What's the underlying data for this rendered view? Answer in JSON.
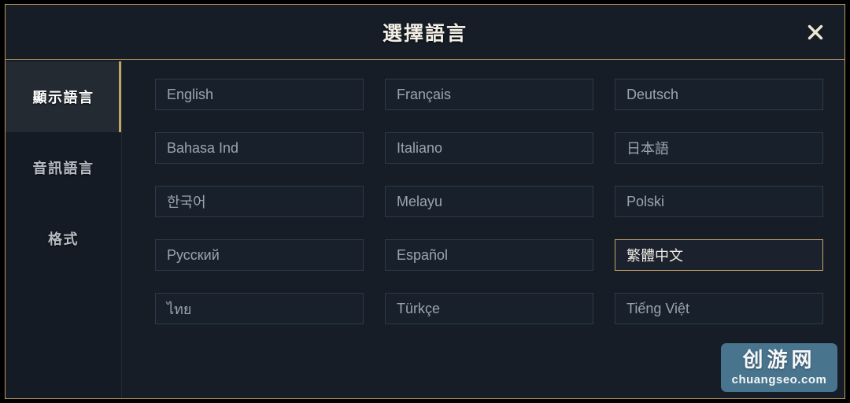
{
  "dialog": {
    "title": "選擇語言",
    "close_icon": "close-icon",
    "accent_color": "#c4a463",
    "background_color": "#161d27",
    "border_color": "#b99b5e"
  },
  "sidebar": {
    "items": [
      {
        "label": "顯示語言",
        "active": true
      },
      {
        "label": "音訊語言",
        "active": false
      },
      {
        "label": "格式",
        "active": false
      }
    ]
  },
  "languages": [
    {
      "label": "English",
      "selected": false
    },
    {
      "label": "Français",
      "selected": false
    },
    {
      "label": "Deutsch",
      "selected": false
    },
    {
      "label": "Bahasa Ind",
      "selected": false
    },
    {
      "label": "Italiano",
      "selected": false
    },
    {
      "label": "日本語",
      "selected": false
    },
    {
      "label": "한국어",
      "selected": false
    },
    {
      "label": "Melayu",
      "selected": false
    },
    {
      "label": "Polski",
      "selected": false
    },
    {
      "label": "Русский",
      "selected": false
    },
    {
      "label": "Español",
      "selected": false
    },
    {
      "label": "繁體中文",
      "selected": true
    },
    {
      "label": "ไทย",
      "selected": false
    },
    {
      "label": "Türkçe",
      "selected": false
    },
    {
      "label": "Tiếng Việt",
      "selected": false
    }
  ],
  "watermark": {
    "brand_cn": "创游网",
    "url": "chuangseo.com",
    "background_color": "#4a7792"
  }
}
